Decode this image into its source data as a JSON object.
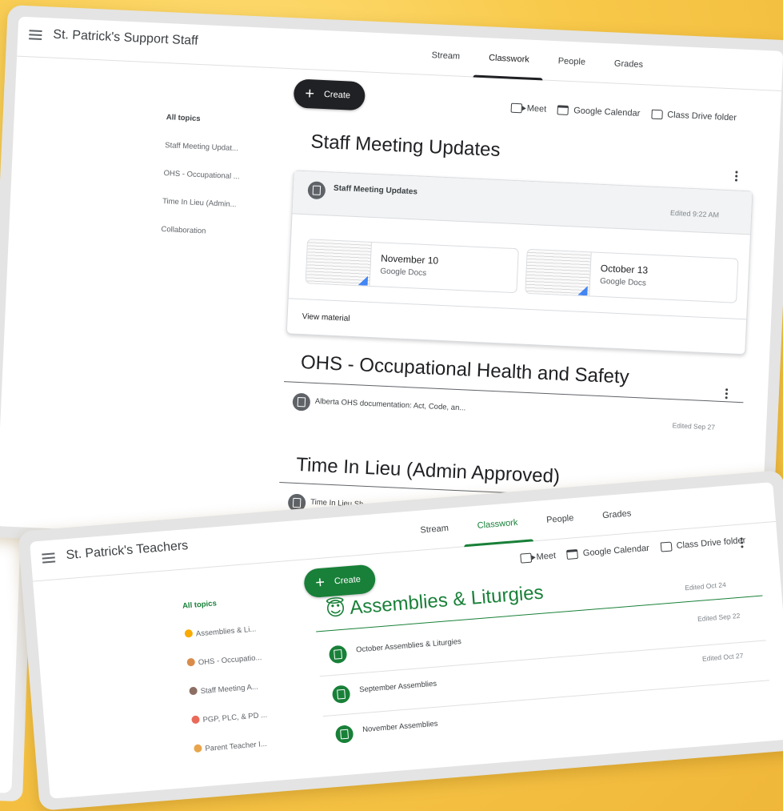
{
  "colors": {
    "dark_create": "#202124",
    "green": "#188038"
  },
  "window1": {
    "class_title": "St. Patrick's Support Staff",
    "tabs": [
      "Stream",
      "Classwork",
      "People",
      "Grades"
    ],
    "active_tab": "Classwork",
    "create_label": "Create",
    "toolbar": {
      "meet": "Meet",
      "calendar": "Google Calendar",
      "drive": "Class Drive folder"
    },
    "topics": [
      "All topics",
      "Staff Meeting Updat...",
      "OHS - Occupational ...",
      "Time In Lieu (Admin...",
      "Collaboration"
    ],
    "sections": [
      {
        "title": "Staff Meeting Updates",
        "material": {
          "title": "Staff Meeting Updates",
          "edited": "Edited 9:22 AM",
          "attachments": [
            {
              "title": "November 10",
              "type": "Google Docs"
            },
            {
              "title": "October 13",
              "type": "Google Docs"
            }
          ],
          "view_label": "View material"
        }
      },
      {
        "title": "OHS - Occupational Health and Safety",
        "items": [
          {
            "label": "Alberta OHS documentation: Act, Code, an...",
            "edited": "Edited Sep 27"
          }
        ]
      },
      {
        "title": "Time In Lieu (Admin Approved)",
        "items": [
          {
            "label": "Time In Lieu Sh..."
          }
        ]
      }
    ]
  },
  "window2": {
    "class_title": "St. Patrick's Teachers",
    "tabs": [
      "Stream",
      "Classwork",
      "People",
      "Grades"
    ],
    "active_tab": "Classwork",
    "create_label": "Create",
    "toolbar": {
      "meet": "Meet",
      "calendar": "Google Calendar",
      "drive": "Class Drive folder"
    },
    "topics": [
      {
        "label": "All topics",
        "emoji_color": ""
      },
      {
        "label": "Assemblies & Li...",
        "emoji_color": "#f9ab00"
      },
      {
        "label": "OHS - Occupatio...",
        "emoji_color": "#d98c4a"
      },
      {
        "label": "Staff Meeting A...",
        "emoji_color": "#8d6e63"
      },
      {
        "label": "PGP, PLC, & PD ...",
        "emoji_color": "#ea6a5a"
      },
      {
        "label": "Parent Teacher I...",
        "emoji_color": "#e8a54b"
      }
    ],
    "section": {
      "title": "Assemblies & Liturgies",
      "emoji": "😇",
      "edited": "Edited Oct 24",
      "items": [
        {
          "label": "October Assemblies & Liturgies",
          "edited": "Edited Sep 22"
        },
        {
          "label": "September Assemblies",
          "edited": "Edited Oct 27"
        },
        {
          "label": "November Assemblies",
          "edited": ""
        }
      ]
    }
  }
}
